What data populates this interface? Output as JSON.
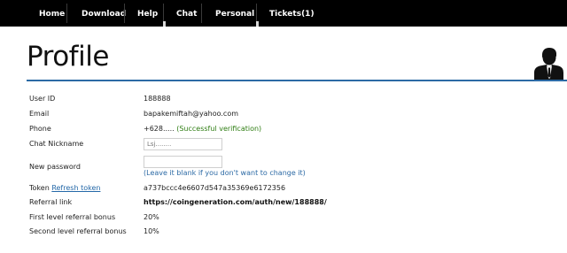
{
  "nav": {
    "items": [
      "Home",
      "Download",
      "Help",
      "Chat",
      "Personal",
      "Tickets(1)"
    ]
  },
  "page": {
    "title": "Profile"
  },
  "profile": {
    "user_id_label": "User ID",
    "user_id_value": "188888",
    "email_label": "Email",
    "email_value": "bapakemiftah@yahoo.com",
    "phone_label": "Phone",
    "phone_value": "+628.....",
    "phone_status": "(Successful verification)",
    "nickname_label": "Chat Nickname",
    "nickname_value": "Lsj........",
    "password_label": "New password",
    "password_value": "",
    "password_hint": "(Leave it blank if you don't want to change it)",
    "token_label": "Token",
    "token_refresh": "Refresh token",
    "token_value": "a737bccc4e6607d547a35369e6172356",
    "referral_label": "Referral link",
    "referral_value": "https://coingeneration.com/auth/new/188888/",
    "first_bonus_label": "First level referral bonus",
    "first_bonus_value": "20%",
    "second_bonus_label": "Second level referral bonus",
    "second_bonus_value": "10%"
  },
  "icons": {
    "user": "businessman-icon"
  },
  "colors": {
    "accent": "#2c6aa5",
    "success": "#2e7d12",
    "nav_bg": "#000000"
  }
}
